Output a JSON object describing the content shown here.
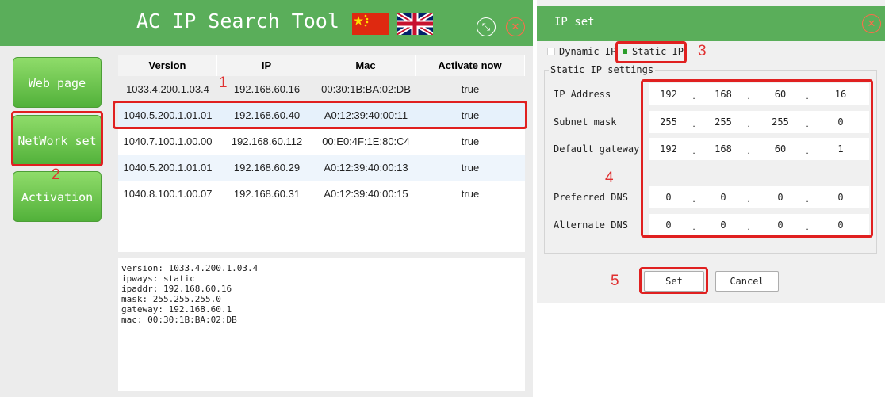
{
  "left_window": {
    "title": "AC IP Search Tool",
    "buttons": {
      "web_page": "Web page",
      "network_set": "NetWork set",
      "activation": "Activation"
    },
    "table": {
      "headers": [
        "Version",
        "IP",
        "Mac",
        "Activate now"
      ],
      "rows": [
        [
          "1033.4.200.1.03.4",
          "192.168.60.16",
          "00:30:1B:BA:02:DB",
          "true"
        ],
        [
          "1040.5.200.1.01.01",
          "192.168.60.40",
          "A0:12:39:40:00:11",
          "true"
        ],
        [
          "1040.7.100.1.00.00",
          "192.168.60.112",
          "00:E0:4F:1E:80:C4",
          "true"
        ],
        [
          "1040.5.200.1.01.01",
          "192.168.60.29",
          "A0:12:39:40:00:13",
          "true"
        ],
        [
          "1040.8.100.1.00.07",
          "192.168.60.31",
          "A0:12:39:40:00:15",
          "true"
        ]
      ]
    },
    "info_lines": [
      "version: 1033.4.200.1.03.4",
      "ipways: static",
      "ipaddr: 192.168.60.16",
      "mask: 255.255.255.0",
      "gateway: 192.168.60.1",
      "mac: 00:30:1B:BA:02:DB"
    ]
  },
  "right_window": {
    "title": "IP set",
    "dynamic_ip": "Dynamic IP",
    "static_ip": "Static IP",
    "group_label": "Static IP settings",
    "fields": [
      {
        "label": "IP Address",
        "octets": [
          "192",
          "168",
          "60",
          "16"
        ]
      },
      {
        "label": "Subnet mask",
        "octets": [
          "255",
          "255",
          "255",
          "0"
        ]
      },
      {
        "label": "Default gateway",
        "octets": [
          "192",
          "168",
          "60",
          "1"
        ]
      },
      {
        "label": "Preferred DNS",
        "octets": [
          "0",
          "0",
          "0",
          "0"
        ]
      },
      {
        "label": "Alternate DNS",
        "octets": [
          "0",
          "0",
          "0",
          "0"
        ]
      }
    ],
    "set_label": "Set",
    "cancel_label": "Cancel"
  },
  "annotations": [
    "1",
    "2",
    "3",
    "4",
    "5"
  ],
  "colors": {
    "title_green": "#5aae5a",
    "button_green": "#6cc84f",
    "highlight_red": "#e02020",
    "selected_row": "#e6f1fb"
  }
}
